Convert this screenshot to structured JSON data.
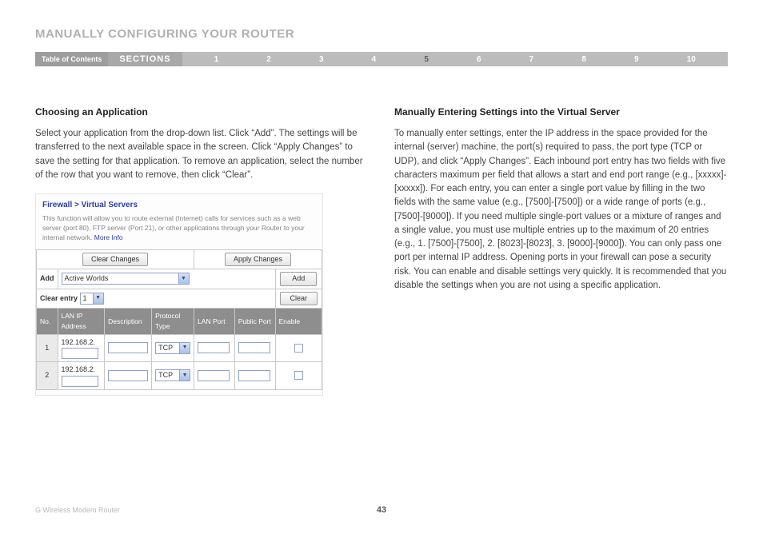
{
  "title": "MANUALLY CONFIGURING YOUR ROUTER",
  "nav": {
    "toc": "Table of Contents",
    "sections_label": "SECTIONS",
    "items": [
      "1",
      "2",
      "3",
      "4",
      "5",
      "6",
      "7",
      "8",
      "9",
      "10"
    ],
    "active": "5"
  },
  "left": {
    "heading": "Choosing an Application",
    "body": "Select your application from the drop-down list. Click “Add”. The settings will be transferred to the next available space in the screen. Click “Apply Changes” to save the setting for that application. To remove an application, select the number of the row that you want to remove, then click “Clear”."
  },
  "panel": {
    "breadcrumb": "Firewall > Virtual Servers",
    "desc": "This function will allow you to route external (Internet) calls for services such as a web server (port 80), FTP server (Port 21), or other applications through your Router to your internal network.",
    "more": "More Info",
    "clear_changes": "Clear Changes",
    "apply_changes": "Apply Changes",
    "add_label": "Add",
    "add_value": "Active Worlds",
    "add_btn": "Add",
    "clear_entry_label": "Clear entry",
    "clear_entry_value": "1",
    "clear_btn": "Clear",
    "cols": {
      "no": "No.",
      "ip": "LAN IP Address",
      "desc": "Description",
      "proto": "Protocol Type",
      "lan": "LAN Port",
      "pub": "Public Port",
      "en": "Enable"
    },
    "rows": [
      {
        "no": "1",
        "ip_prefix": "192.168.2.",
        "proto": "TCP"
      },
      {
        "no": "2",
        "ip_prefix": "192.168.2.",
        "proto": "TCP"
      }
    ]
  },
  "right": {
    "heading": "Manually Entering Settings into the Virtual Server",
    "body": "To manually enter settings, enter the IP address in the space provided for the internal (server) machine, the port(s) required to pass, the port type (TCP or UDP), and click “Apply Changes”. Each inbound port entry has two fields with five characters maximum per field that allows a start and end port range (e.g., [xxxxx]-[xxxxx]). For each entry, you can enter a single port value by filling in the two fields with the same value (e.g., [7500]-[7500]) or a wide range of ports (e.g., [7500]-[9000]). If you need multiple single-port values or a mixture of ranges and a single value, you must use multiple entries up to the maximum of 20 entries (e.g., 1. [7500]-[7500], 2. [8023]-[8023], 3. [9000]-[9000]). You can only pass one port per internal IP address. Opening ports in your firewall can pose a security risk. You can enable and disable settings very quickly. It is recommended that you disable the settings when you are not using a specific application."
  },
  "footer": {
    "product": "G Wireless Modem Router",
    "page": "43"
  }
}
